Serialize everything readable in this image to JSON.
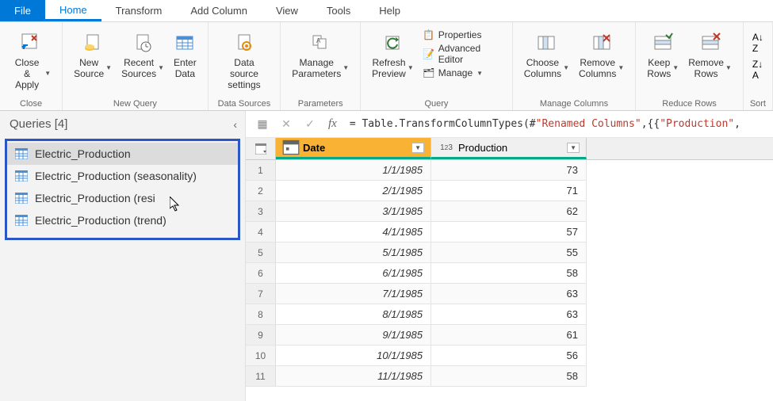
{
  "menu": {
    "file": "File",
    "tabs": [
      "Home",
      "Transform",
      "Add Column",
      "View",
      "Tools",
      "Help"
    ],
    "active": "Home"
  },
  "ribbon": {
    "close_apply": "Close &\nApply",
    "new_source": "New\nSource",
    "recent_sources": "Recent\nSources",
    "enter_data": "Enter\nData",
    "data_source_settings": "Data source\nsettings",
    "manage_parameters": "Manage\nParameters",
    "refresh_preview": "Refresh\nPreview",
    "properties": "Properties",
    "advanced_editor": "Advanced Editor",
    "manage": "Manage",
    "choose_columns": "Choose\nColumns",
    "remove_columns": "Remove\nColumns",
    "keep_rows": "Keep\nRows",
    "remove_rows": "Remove\nRows",
    "groups": {
      "close": "Close",
      "new_query": "New Query",
      "data_sources": "Data Sources",
      "parameters": "Parameters",
      "query": "Query",
      "manage_columns": "Manage Columns",
      "reduce_rows": "Reduce Rows",
      "sort": "Sort"
    }
  },
  "sidebar": {
    "title": "Queries [4]",
    "items": [
      {
        "label": "Electric_Production"
      },
      {
        "label": "Electric_Production (seasonality)"
      },
      {
        "label": "Electric_Production (resi"
      },
      {
        "label": "Electric_Production (trend)"
      }
    ]
  },
  "formula": {
    "prefix": "= Table.TransformColumnTypes(#",
    "string1": "\"Renamed Columns\"",
    "mid": ",{{",
    "string2": "\"Production\"",
    "suffix": ","
  },
  "grid": {
    "columns": [
      {
        "name": "Date",
        "type": "date"
      },
      {
        "name": "Production",
        "type": "int"
      }
    ],
    "rows": [
      {
        "n": 1,
        "date": "1/1/1985",
        "prod": 73
      },
      {
        "n": 2,
        "date": "2/1/1985",
        "prod": 71
      },
      {
        "n": 3,
        "date": "3/1/1985",
        "prod": 62
      },
      {
        "n": 4,
        "date": "4/1/1985",
        "prod": 57
      },
      {
        "n": 5,
        "date": "5/1/1985",
        "prod": 55
      },
      {
        "n": 6,
        "date": "6/1/1985",
        "prod": 58
      },
      {
        "n": 7,
        "date": "7/1/1985",
        "prod": 63
      },
      {
        "n": 8,
        "date": "8/1/1985",
        "prod": 63
      },
      {
        "n": 9,
        "date": "9/1/1985",
        "prod": 61
      },
      {
        "n": 10,
        "date": "10/1/1985",
        "prod": 56
      },
      {
        "n": 11,
        "date": "11/1/1985",
        "prod": 58
      }
    ]
  }
}
